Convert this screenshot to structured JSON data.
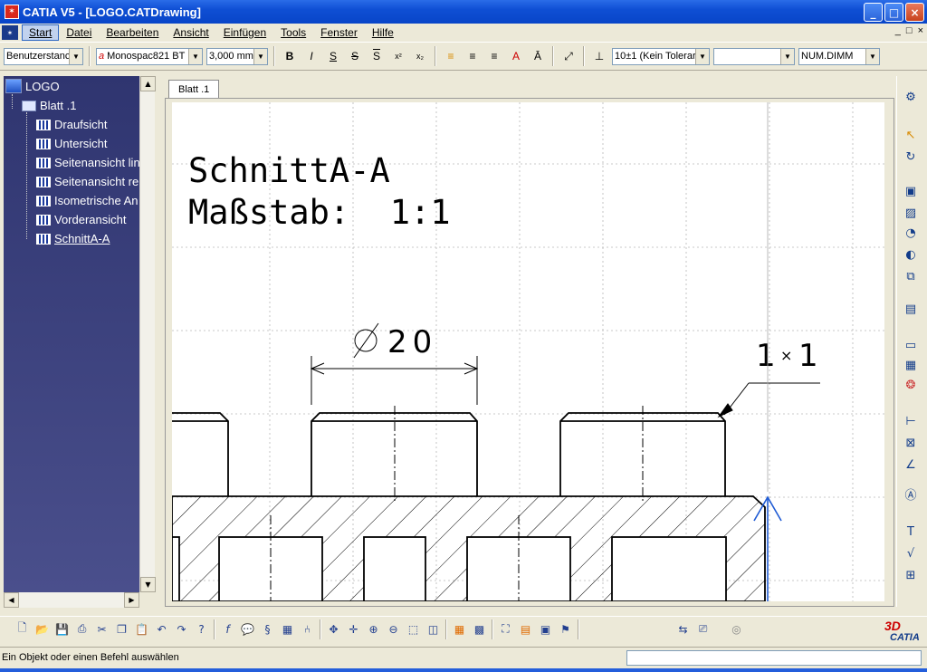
{
  "window": {
    "title": "CATIA V5 - [LOGO.CATDrawing]",
    "min": "_",
    "max": "□",
    "close": "×"
  },
  "menu": {
    "items": [
      "Start",
      "Datei",
      "Bearbeiten",
      "Ansicht",
      "Einfügen",
      "Tools",
      "Fenster",
      "Hilfe"
    ],
    "mdi": [
      "_",
      "□",
      "×"
    ]
  },
  "toolbar": {
    "style": "Benutzerstanc",
    "font": "Monospac821 BT",
    "size": "3,000 mm",
    "bold": "B",
    "italic": "I",
    "underline": "S",
    "strike": "S",
    "overline": "S",
    "superscript": "x²",
    "subscript": "x₂",
    "tolerance": "10±1 (Kein Tolerar",
    "blank": "",
    "dim": "NUM.DIMM"
  },
  "tree": {
    "root": "LOGO",
    "sheet": "Blatt .1",
    "views": [
      "Draufsicht",
      "Untersicht",
      "Seitenansicht lin",
      "Seitenansicht re",
      "Isometrische An",
      "Vorderansicht",
      "SchnittA-A"
    ]
  },
  "tab": {
    "label": "Blatt .1"
  },
  "drawing": {
    "title_line1": "SchnittA-A",
    "title_line2": "Maßstab:  1:1",
    "dim_diameter": "20",
    "dim_chamfer_a": "1",
    "dim_chamfer_x": "×",
    "dim_chamfer_b": "1"
  },
  "status": {
    "message": "Ein Objekt oder einen Befehl auswählen"
  },
  "logo": {
    "text": "CATIA"
  },
  "colors": {
    "tree_bg": "#2f3570",
    "titlebar": "#0f4fd4",
    "section_arrow": "#1f5bd4",
    "grid": "#b8b8b8"
  }
}
